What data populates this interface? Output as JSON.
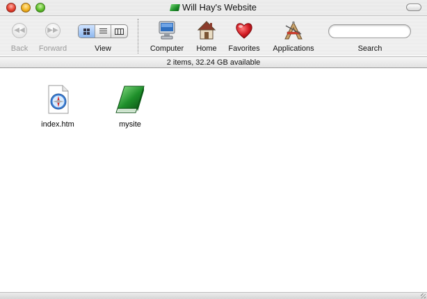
{
  "window": {
    "title": "Will Hay's Website"
  },
  "toolbar": {
    "back_label": "Back",
    "forward_label": "Forward",
    "view_label": "View",
    "computer_label": "Computer",
    "home_label": "Home",
    "favorites_label": "Favorites",
    "applications_label": "Applications",
    "search_label": "Search",
    "search_value": "",
    "active_view": "icon",
    "icons": {
      "back": "back-arrow-icon",
      "forward": "forward-arrow-icon",
      "computer": "monitor-icon",
      "home": "house-icon",
      "favorites": "heart-icon",
      "applications": "applications-a-icon"
    }
  },
  "status": {
    "text": "2 items, 32.24 GB available"
  },
  "files": [
    {
      "name": "index.htm",
      "icon": "html-document-icon"
    },
    {
      "name": "mysite",
      "icon": "green-book-icon"
    }
  ],
  "colors": {
    "heart": "#d11a22",
    "book_green": "#1e8f2a",
    "view_active": "#8db7ef"
  }
}
